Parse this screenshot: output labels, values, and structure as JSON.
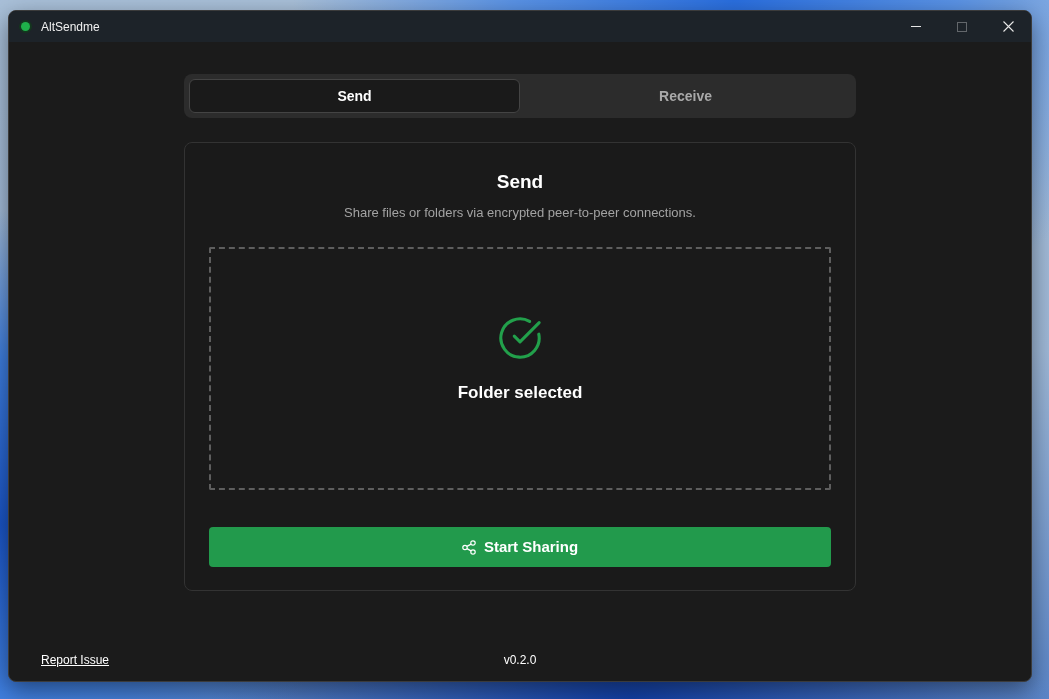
{
  "window": {
    "title": "AltSendme",
    "controls": [
      {
        "kind": "minimize",
        "disabled": false
      },
      {
        "kind": "maximize",
        "disabled": true
      },
      {
        "kind": "close",
        "disabled": false
      }
    ]
  },
  "tabs": [
    {
      "label": "Send",
      "selected": true
    },
    {
      "label": "Receive",
      "selected": false
    }
  ],
  "panel": {
    "title": "Send",
    "subtitle": "Share files or folders via encrypted peer-to-peer connections.",
    "dropzone": {
      "status": "Folder selected",
      "selected": true
    },
    "button": {
      "label": "Start Sharing"
    }
  },
  "footer": {
    "link": "Report Issue",
    "version": "v0.2.0"
  }
}
